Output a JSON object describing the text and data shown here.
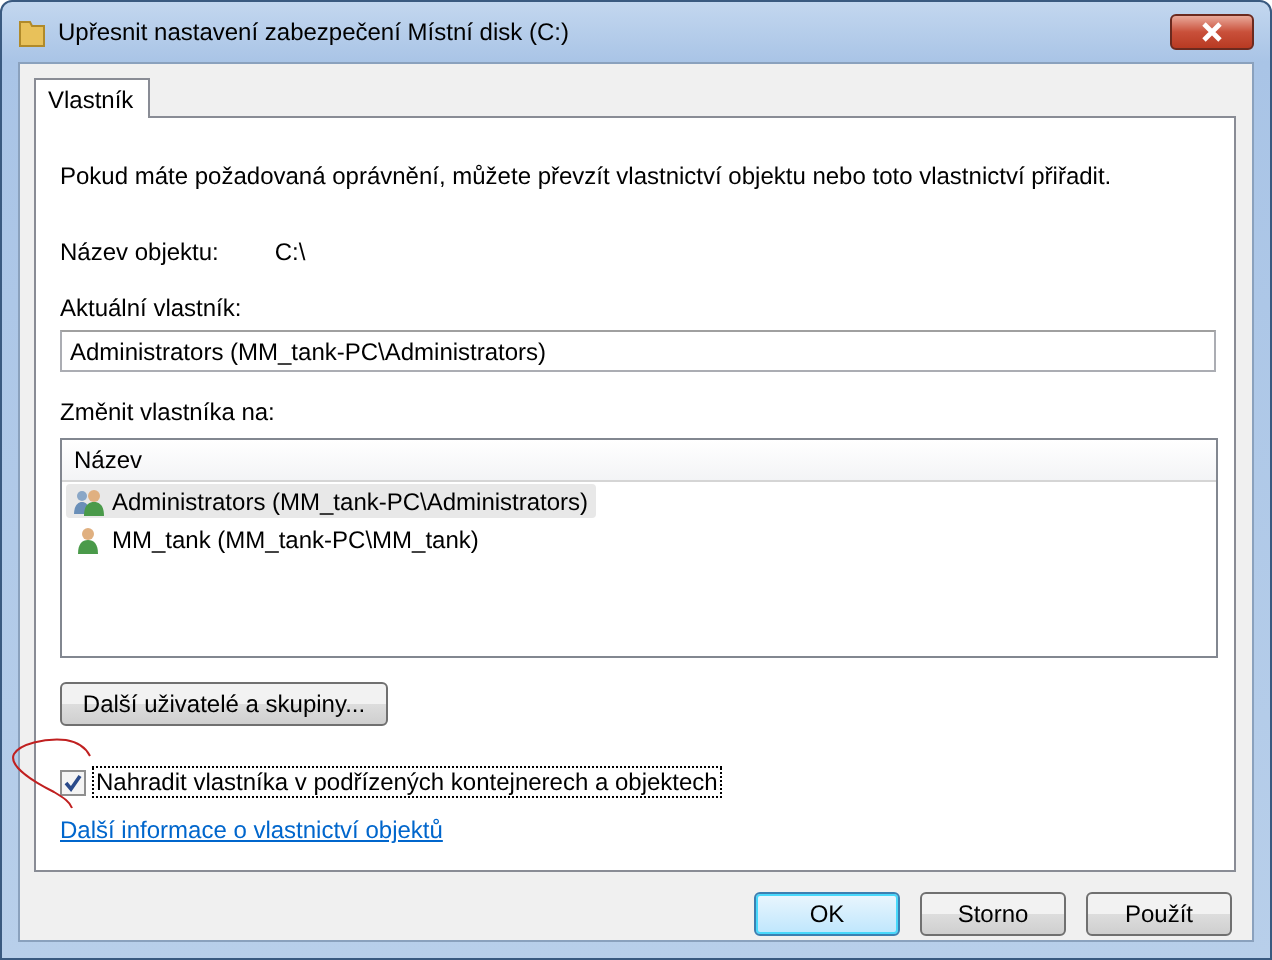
{
  "window": {
    "title": "Upřesnit nastavení zabezpečení Místní disk (C:)"
  },
  "tabs": [
    {
      "label": "Vlastník",
      "selected": true
    }
  ],
  "intro": "Pokud máte požadovaná oprávnění, můžete převzít vlastnictví objektu nebo toto vlastnictví přiřadit.",
  "object_name": {
    "label": "Název objektu:",
    "value": "C:\\"
  },
  "current_owner": {
    "label": "Aktuální vlastník:",
    "value": "Administrators (MM_tank-PC\\Administrators)"
  },
  "change_owner": {
    "label": "Změnit vlastníka na:",
    "column": "Název",
    "rows": [
      {
        "kind": "group",
        "name": "Administrators (MM_tank-PC\\Administrators)",
        "selected": true
      },
      {
        "kind": "user",
        "name": "MM_tank (MM_tank-PC\\MM_tank)",
        "selected": false
      }
    ]
  },
  "more_users_button": "Další uživatelé a skupiny...",
  "replace_owner": {
    "label": "Nahradit vlastníka v podřízených kontejnerech a objektech",
    "checked": true
  },
  "info_link": "Další informace o vlastnictví objektů",
  "buttons": [
    {
      "label": "OK",
      "default": true
    },
    {
      "label": "Storno",
      "default": false
    },
    {
      "label": "Použít",
      "default": false
    }
  ]
}
